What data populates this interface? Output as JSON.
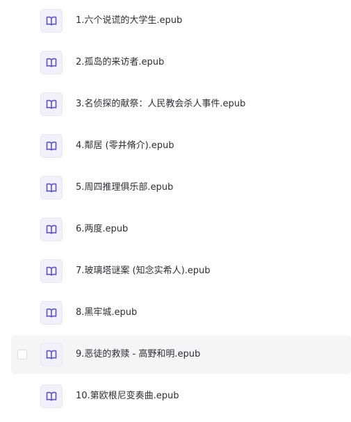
{
  "files": [
    {
      "name": "1.六个说谎的大学生.epub",
      "icon": "book-icon",
      "hovered": false
    },
    {
      "name": "2.孤岛的来访者.epub",
      "icon": "book-icon",
      "hovered": false
    },
    {
      "name": "3.名侦探的献祭：人民教会杀人事件.epub",
      "icon": "book-icon",
      "hovered": false
    },
    {
      "name": "4.鄰居 (零井脩介).epub",
      "icon": "book-icon",
      "hovered": false
    },
    {
      "name": "5.周四推理俱乐部.epub",
      "icon": "book-icon",
      "hovered": false
    },
    {
      "name": "6.两度.epub",
      "icon": "book-icon",
      "hovered": false
    },
    {
      "name": "7.玻璃塔谜案 (知念实希人).epub",
      "icon": "book-icon",
      "hovered": false
    },
    {
      "name": "8.黑牢城.epub",
      "icon": "book-icon",
      "hovered": false
    },
    {
      "name": "9.恶徒的救赎 - 高野和明.epub",
      "icon": "book-icon",
      "hovered": true
    },
    {
      "name": "10.第欧根尼变奏曲.epub",
      "icon": "book-icon",
      "hovered": false
    }
  ],
  "colors": {
    "icon_stroke": "#5b4fd6",
    "icon_bg": "#f2f0fb",
    "hover_bg": "#f5f5f6",
    "text": "#2c2c33"
  }
}
